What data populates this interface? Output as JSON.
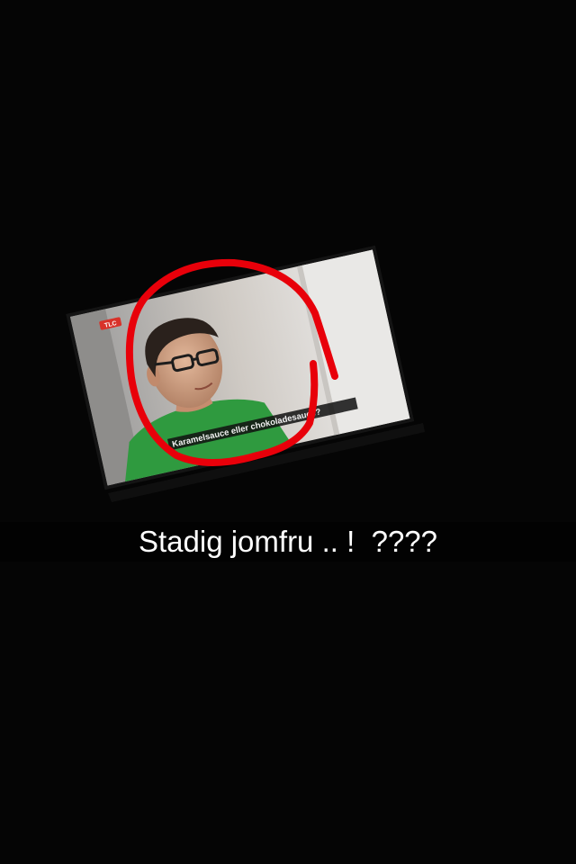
{
  "photo": {
    "description_hidden": "",
    "channel_logo": "TLC",
    "subtitle_text": "Karamelsauce eller chokoladesauce?",
    "annotation_color": "#e8000a"
  },
  "caption": {
    "text": "Stadig jomfru .. !  ????"
  }
}
